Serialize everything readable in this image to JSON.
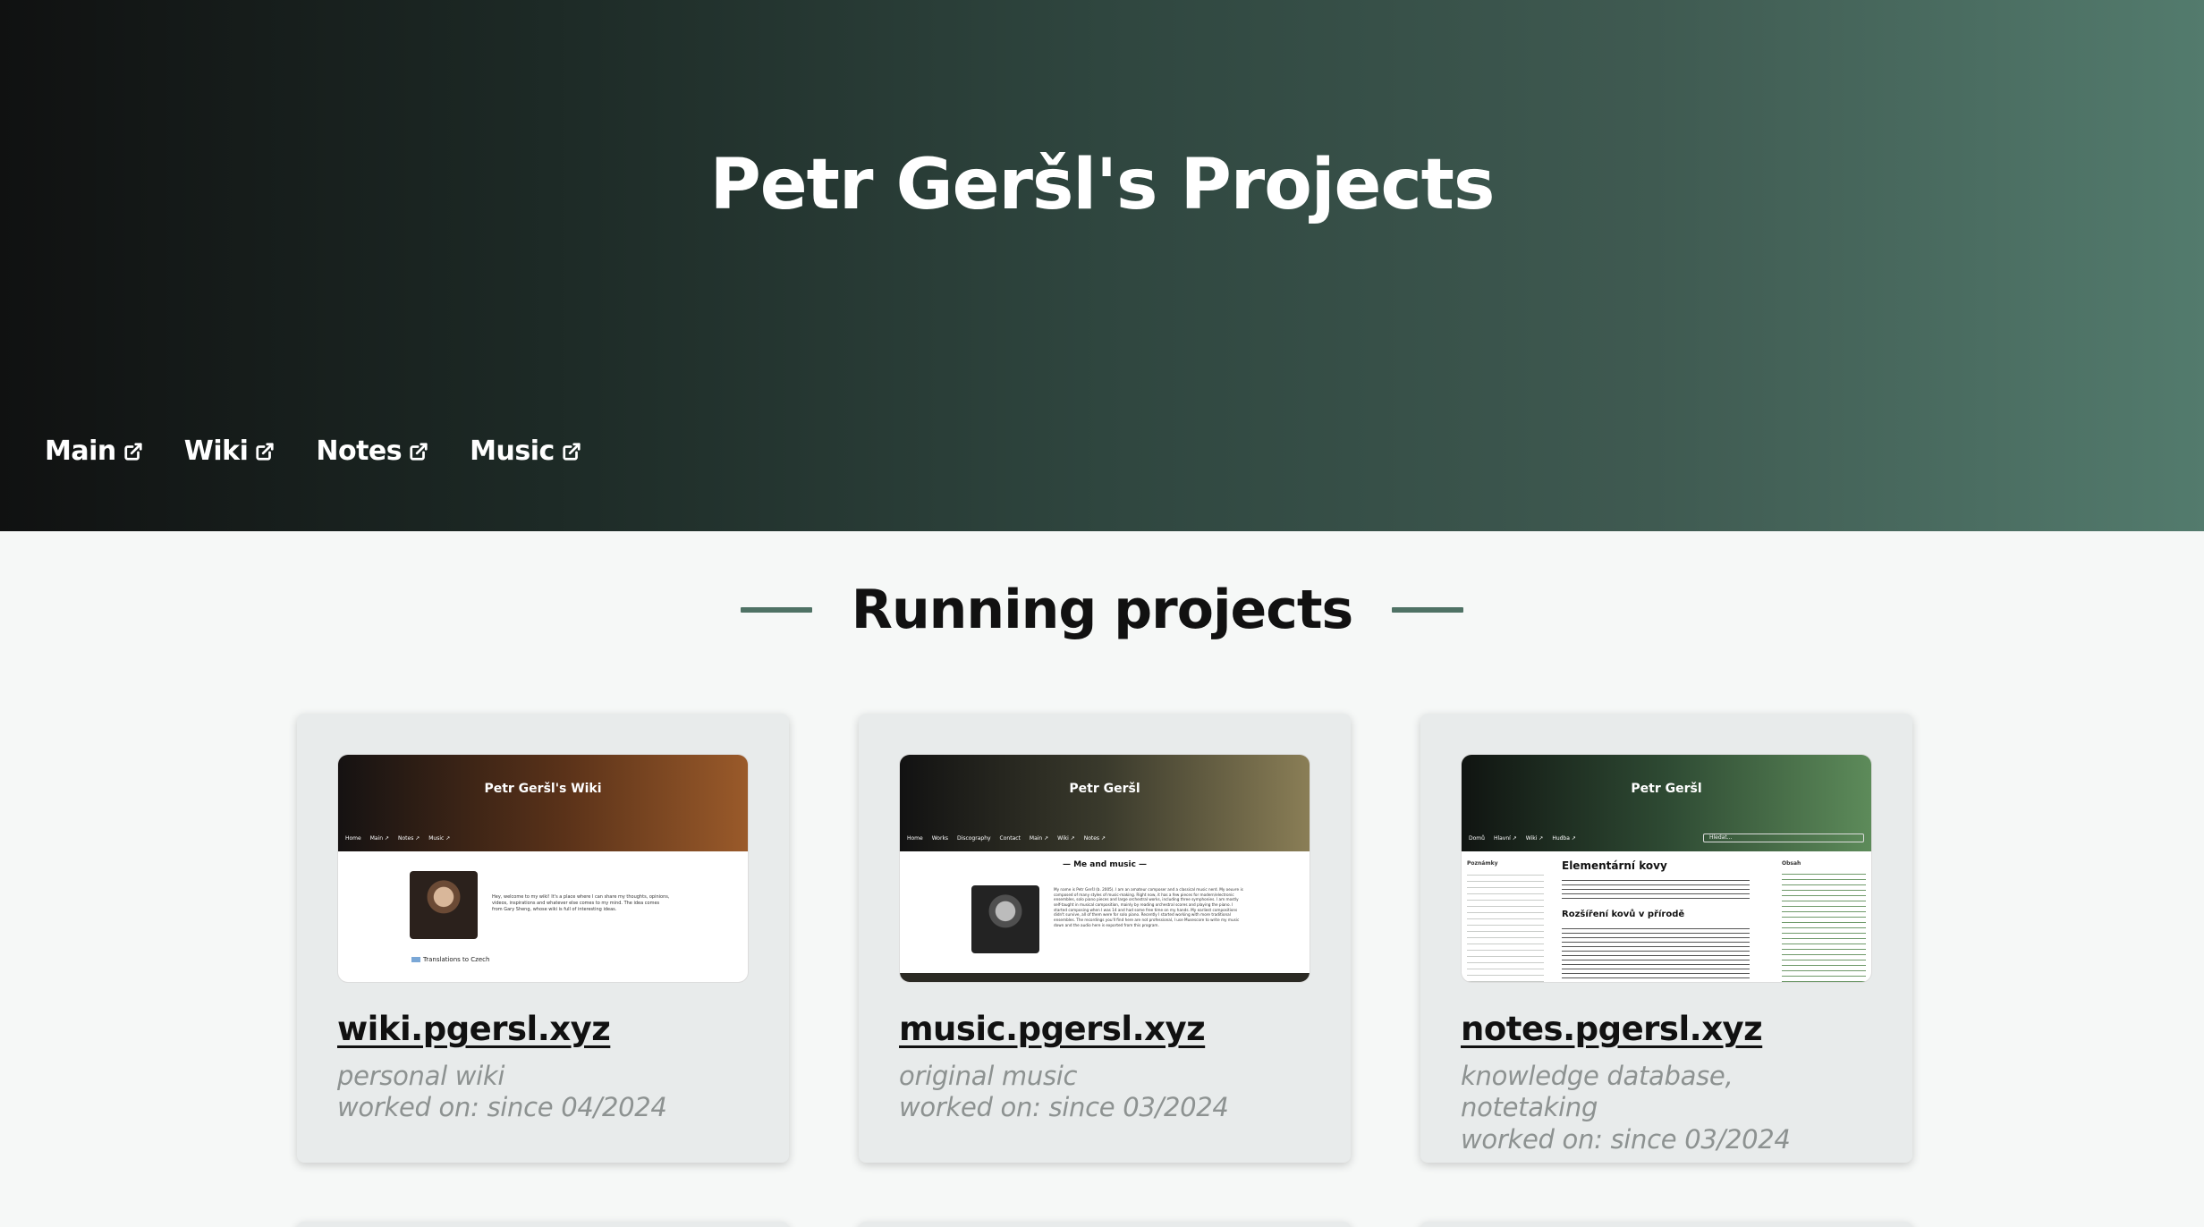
{
  "header": {
    "title": "Petr Geršl's Projects",
    "nav": [
      {
        "label": "Main",
        "icon": "external-link-icon"
      },
      {
        "label": "Wiki",
        "icon": "external-link-icon"
      },
      {
        "label": "Notes",
        "icon": "external-link-icon"
      },
      {
        "label": "Music",
        "icon": "external-link-icon"
      }
    ]
  },
  "section": {
    "title": "Running projects",
    "accent": "#4f7265"
  },
  "projects": [
    {
      "link": "wiki.pgersl.xyz",
      "description": "personal wiki",
      "worked_on": "worked on: since 04/2024",
      "preview": {
        "title": "Petr Geršl's Wiki",
        "nav": [
          "Home",
          "Main ↗",
          "Notes ↗",
          "Music ↗"
        ],
        "body": "Hey, welcome to my wiki! It's a place where I can share my thoughts, opinions, videos, inspirations and whatever else comes to my mind. The idea comes from Gary Sheng, whose wiki is full of interesting ideas.",
        "badge": "Translations to Czech",
        "colors": [
          "#151212",
          "#5a3219",
          "#9a5a2a"
        ]
      }
    },
    {
      "link": "music.pgersl.xyz",
      "description": "original music",
      "worked_on": "worked on: since 03/2024",
      "preview": {
        "title": "Petr Geršl",
        "nav": [
          "Home",
          "Works",
          "Discography",
          "Contact",
          "Main ↗",
          "Wiki ↗",
          "Notes ↗"
        ],
        "subtitle": "Me and music",
        "body": "My name is Petr Geršl (b. 2005). I am an amateur composer and a classical music nerd. My oeuvre is composed of many styles of music-making. Right now, it has a few pieces for modern/electronic ensembles, solo piano pieces and large orchestral works, including three symphonies. I am mostly self-taught in musical composition, mainly by reading orchestral scores and playing the piano. I started composing when I was 14 and had some free time on my hands. My earliest compositions didn't survive, all of them were for solo piano. Recently I started working with more traditional ensembles. The recordings you'll find here are not professional, I use Musescore to write my music down and the audio here is exported from this program.",
        "colors": [
          "#121212",
          "#3a3a2c",
          "#8a7e56"
        ]
      },
      "colors_placeholder": ""
    },
    {
      "link": "notes.pgersl.xyz",
      "description": "knowledge database, notetaking",
      "worked_on": "worked on: since 03/2024",
      "preview": {
        "title": "Petr Geršl",
        "nav": [
          "Domů",
          "Hlavní ↗",
          "Wiki ↗",
          "Hudba ↗"
        ],
        "search_placeholder": "Hledat...",
        "heading": "Elementární kovy",
        "subheading": "Rozšíření kovů v přírodě",
        "sidebar_title": "Poznámky",
        "toc_title": "Obsah",
        "colors": [
          "#101411",
          "#2e4a33",
          "#5d8b5a"
        ]
      }
    }
  ]
}
